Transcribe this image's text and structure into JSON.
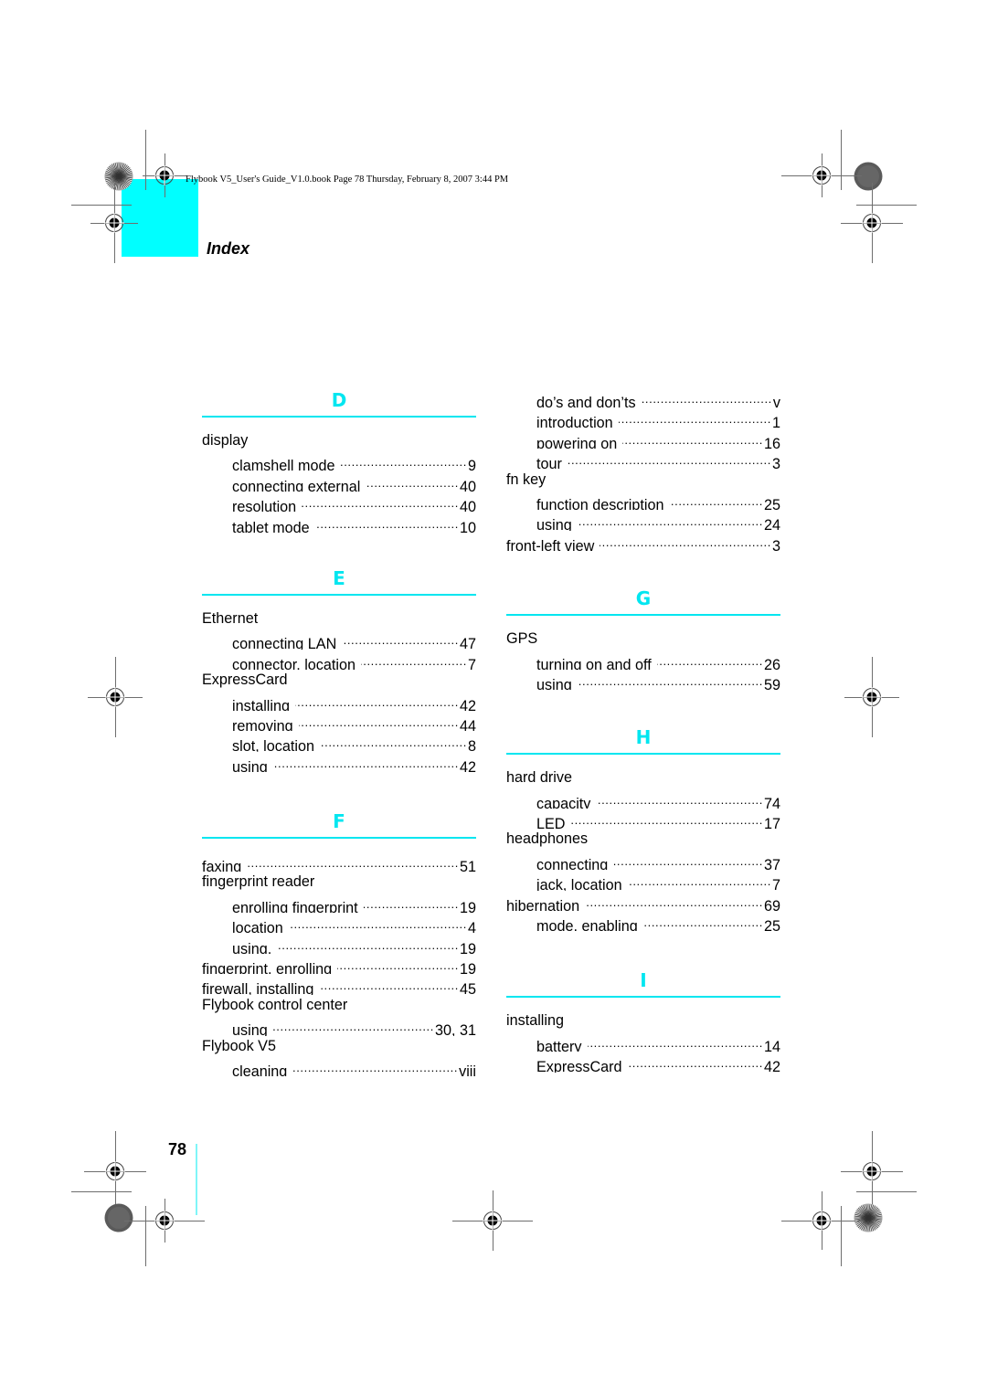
{
  "header": {
    "running_head": "Flybook V5_User's Guide_V1.0.book  Page 78  Thursday, February 8, 2007  3:44 PM",
    "title": "Index",
    "accent_color": "#00ffff"
  },
  "footer": {
    "page_number": "78"
  },
  "left_column": {
    "sections": [
      {
        "letter": "D",
        "entries": [
          {
            "term": "display",
            "page": "",
            "level": 0
          },
          {
            "term": "clamshell mode",
            "page": "9",
            "level": 1
          },
          {
            "term": "connecting external",
            "page": "40",
            "level": 1
          },
          {
            "term": "resolution",
            "page": "40",
            "level": 1
          },
          {
            "term": "tablet mode",
            "page": "10",
            "level": 1
          }
        ]
      },
      {
        "letter": "E",
        "entries": [
          {
            "term": "Ethernet",
            "page": "",
            "level": 0
          },
          {
            "term": "connecting LAN",
            "page": "47",
            "level": 1
          },
          {
            "term": "connector, location",
            "page": "7",
            "level": 1
          },
          {
            "term": "ExpressCard",
            "page": "",
            "level": 0
          },
          {
            "term": "installing",
            "page": "42",
            "level": 1
          },
          {
            "term": "removing",
            "page": "44",
            "level": 1
          },
          {
            "term": "slot, location",
            "page": "8",
            "level": 1
          },
          {
            "term": "using",
            "page": "42",
            "level": 1
          }
        ]
      },
      {
        "letter": "F",
        "entries": [
          {
            "term": "faxing",
            "page": "51",
            "level": 0
          },
          {
            "term": "fingerprint reader",
            "page": "",
            "level": 0
          },
          {
            "term": "enrolling fingerprint",
            "page": "19",
            "level": 1
          },
          {
            "term": "location",
            "page": "4",
            "level": 1
          },
          {
            "term": "using,",
            "page": "19",
            "level": 1
          },
          {
            "term": "fingerprint, enrolling",
            "page": "19",
            "level": 0
          },
          {
            "term": "firewall, installing",
            "page": "45",
            "level": 0
          },
          {
            "term": "Flybook control center",
            "page": "",
            "level": 0
          },
          {
            "term": "using",
            "page": "30, 31",
            "level": 1
          },
          {
            "term": "Flybook V5",
            "page": "",
            "level": 0
          },
          {
            "term": "cleaning",
            "page": "viii",
            "level": 1
          }
        ]
      }
    ]
  },
  "right_column": {
    "continued_entries": [
      {
        "term": "do’s and don’ts",
        "page": "v",
        "level": 1
      },
      {
        "term": "introduction",
        "page": "1",
        "level": 1
      },
      {
        "term": "powering on",
        "page": "16",
        "level": 1
      },
      {
        "term": "tour",
        "page": "3",
        "level": 1
      },
      {
        "term": "fn key",
        "page": "",
        "level": 0
      },
      {
        "term": "function description",
        "page": "25",
        "level": 1
      },
      {
        "term": "using",
        "page": "24",
        "level": 1
      },
      {
        "term": "front-left view",
        "page": "3",
        "level": 0
      }
    ],
    "sections": [
      {
        "letter": "G",
        "entries": [
          {
            "term": "GPS",
            "page": "",
            "level": 0
          },
          {
            "term": "turning on and off",
            "page": "26",
            "level": 1
          },
          {
            "term": "using",
            "page": "59",
            "level": 1
          }
        ]
      },
      {
        "letter": "H",
        "entries": [
          {
            "term": "hard drive",
            "page": "",
            "level": 0
          },
          {
            "term": "capacity",
            "page": "74",
            "level": 1
          },
          {
            "term": "LED",
            "page": "17",
            "level": 1
          },
          {
            "term": "headphones",
            "page": "",
            "level": 0
          },
          {
            "term": "connecting",
            "page": "37",
            "level": 1
          },
          {
            "term": "jack, location",
            "page": "7",
            "level": 1
          },
          {
            "term": "hibernation",
            "page": "69",
            "level": 0
          },
          {
            "term": "mode, enabling",
            "page": "25",
            "level": 1
          }
        ]
      },
      {
        "letter": "I",
        "entries": [
          {
            "term": "installing",
            "page": "",
            "level": 0
          },
          {
            "term": "battery",
            "page": "14",
            "level": 1
          },
          {
            "term": "ExpressCard",
            "page": "42",
            "level": 1
          }
        ]
      }
    ]
  }
}
